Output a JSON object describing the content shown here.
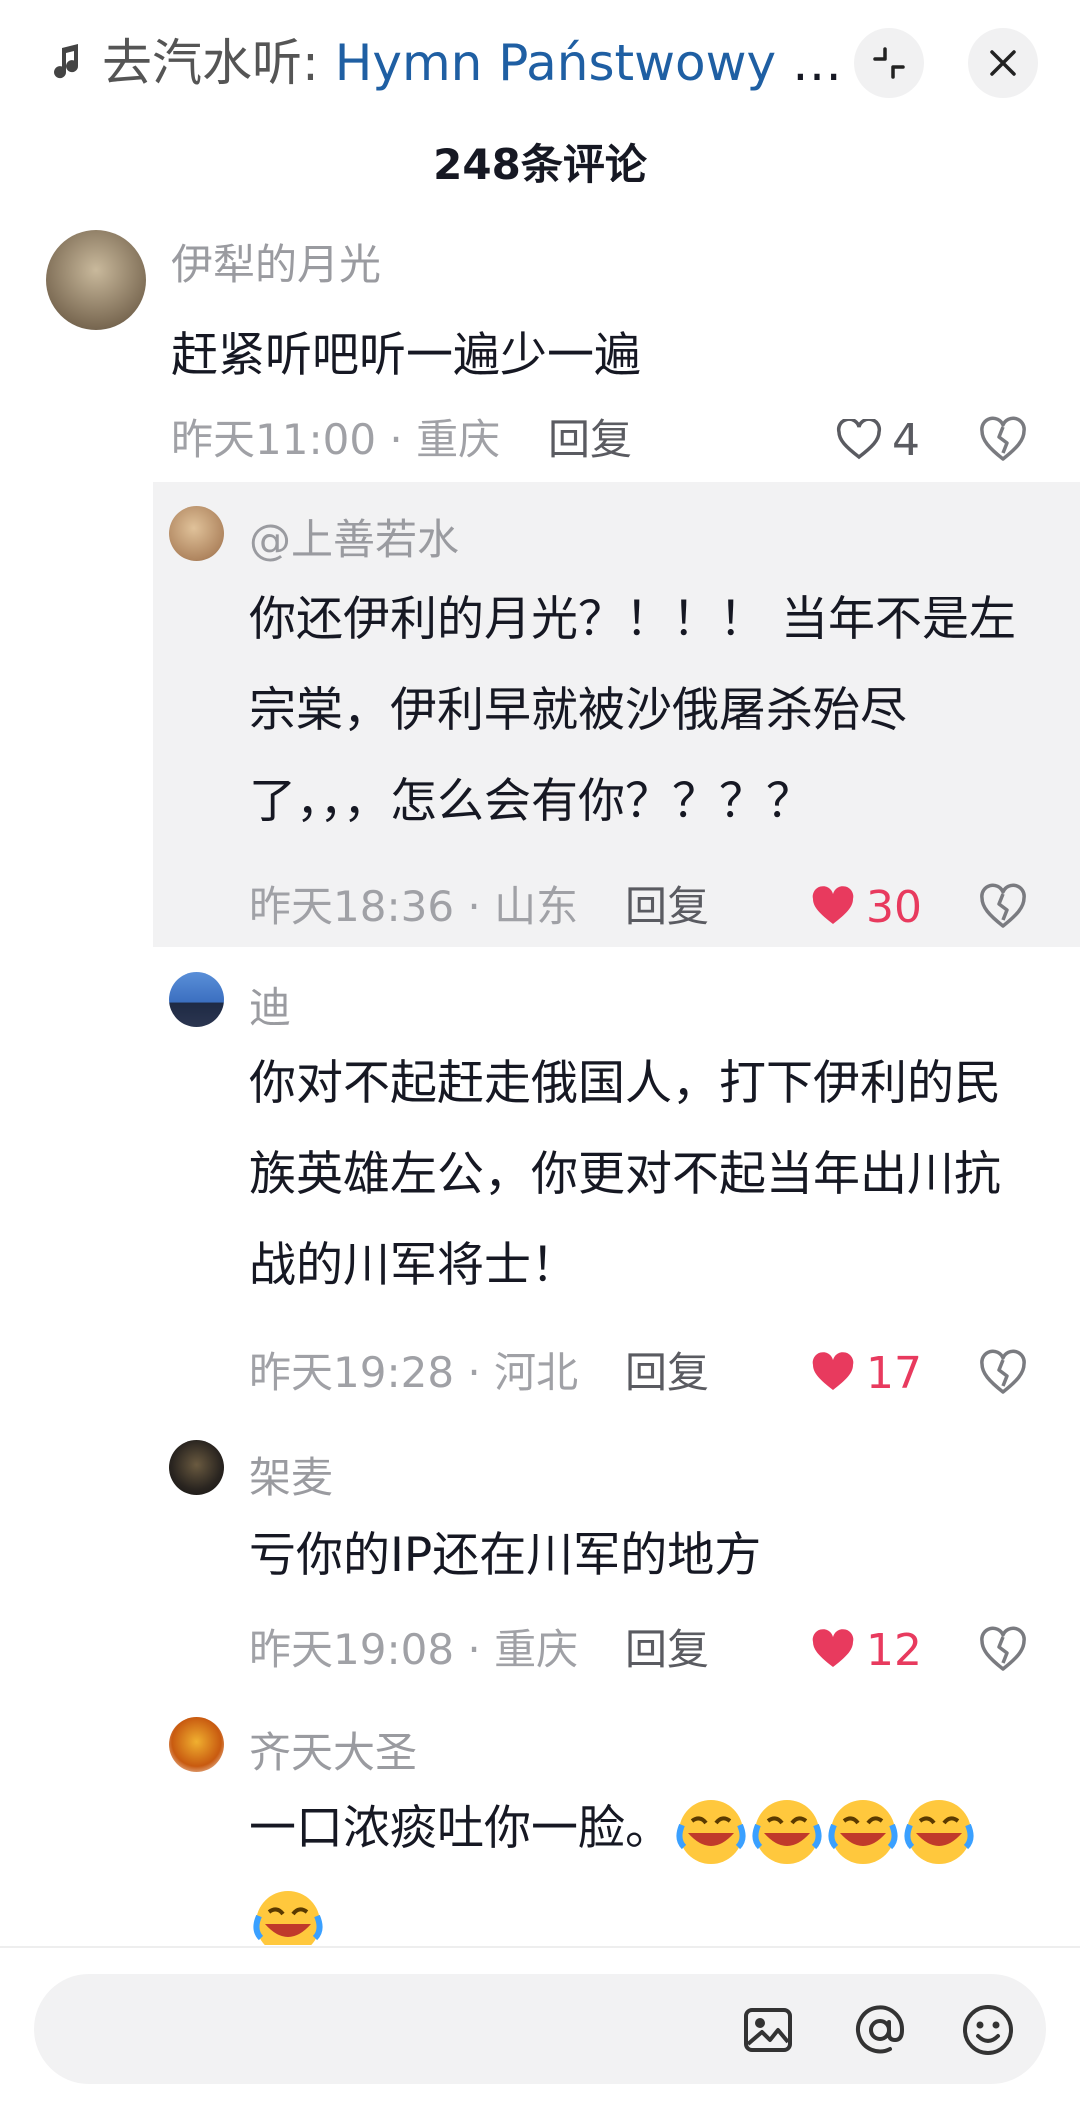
{
  "header": {
    "prefix": "去汽水听: ",
    "song": "Hymn Państwowy U...",
    "comment_count": "248条评论"
  },
  "comments": [
    {
      "username": "伊犁的月光",
      "text": "赶紧听吧听一遍少一遍",
      "meta": "昨天11:00 · 重庆",
      "reply": "回复",
      "likes": "4",
      "liked": false
    },
    {
      "username": "@上善若水",
      "text": "你还伊利的月光？！！！ 当年不是左宗棠，伊利早就被沙俄屠杀殆尽了，，，怎么会有你？？？？",
      "meta": "昨天18:36 · 山东",
      "reply": "回复",
      "likes": "30",
      "liked": true
    },
    {
      "username": "迪",
      "text": "你对不起赶走俄国人，打下伊利的民族英雄左公，你更对不起当年出川抗战的川军将士！",
      "meta": "昨天19:28 · 河北",
      "reply": "回复",
      "likes": "17",
      "liked": true
    },
    {
      "username": "架麦",
      "text": "亏你的IP还在川军的地方",
      "meta": "昨天19:08 · 重庆",
      "reply": "回复",
      "likes": "12",
      "liked": true
    },
    {
      "username": "齐天大圣",
      "text": "一口浓痰吐你一脸。",
      "emoji_count": 5
    }
  ],
  "input": {
    "placeholder": ""
  },
  "colors": {
    "liked": "#e83a5e",
    "link": "#1f5fa3",
    "highlight_bg": "#f2f2f3"
  },
  "icons": [
    "music-note-icon",
    "shrink-icon",
    "close-icon",
    "heart-icon",
    "dislike-heart-icon",
    "image-icon",
    "at-icon",
    "emoji-face-icon",
    "laughing-crying-emoji"
  ]
}
